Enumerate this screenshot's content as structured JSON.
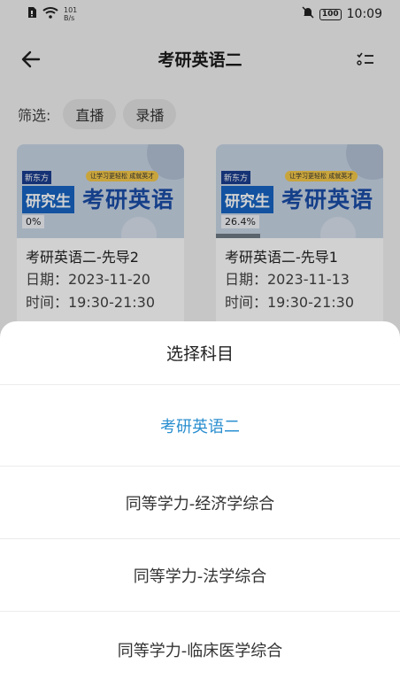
{
  "status_bar": {
    "net_speed_value": "101",
    "net_speed_unit": "B/s",
    "battery": "100",
    "time": "10:09"
  },
  "header": {
    "title": "考研英语二"
  },
  "filter": {
    "label": "筛选:",
    "chips": [
      "直播",
      "录播"
    ]
  },
  "courses": [
    {
      "brand": "新东方",
      "slogan": "让学习更轻松 成就英才",
      "thumb_tag": "研究生",
      "thumb_title": "考研英语",
      "progress_label": "0%",
      "progress": 0,
      "title": "考研英语二-先导2",
      "date": "日期：2023-11-20",
      "time": "时间：19:30-21:30"
    },
    {
      "brand": "新东方",
      "slogan": "让学习更轻松 成就英才",
      "thumb_tag": "研究生",
      "thumb_title": "考研英语",
      "progress_label": "26.4%",
      "progress": 0.264,
      "title": "考研英语二-先导1",
      "date": "日期：2023-11-13",
      "time": "时间：19:30-21:30"
    }
  ],
  "sheet": {
    "title": "选择科目",
    "items": [
      "考研英语二",
      "同等学力-经济学综合",
      "同等学力-法学综合",
      "同等学力-临床医学综合"
    ],
    "selected_index": 0,
    "selected_color": "#2b8fd0"
  }
}
